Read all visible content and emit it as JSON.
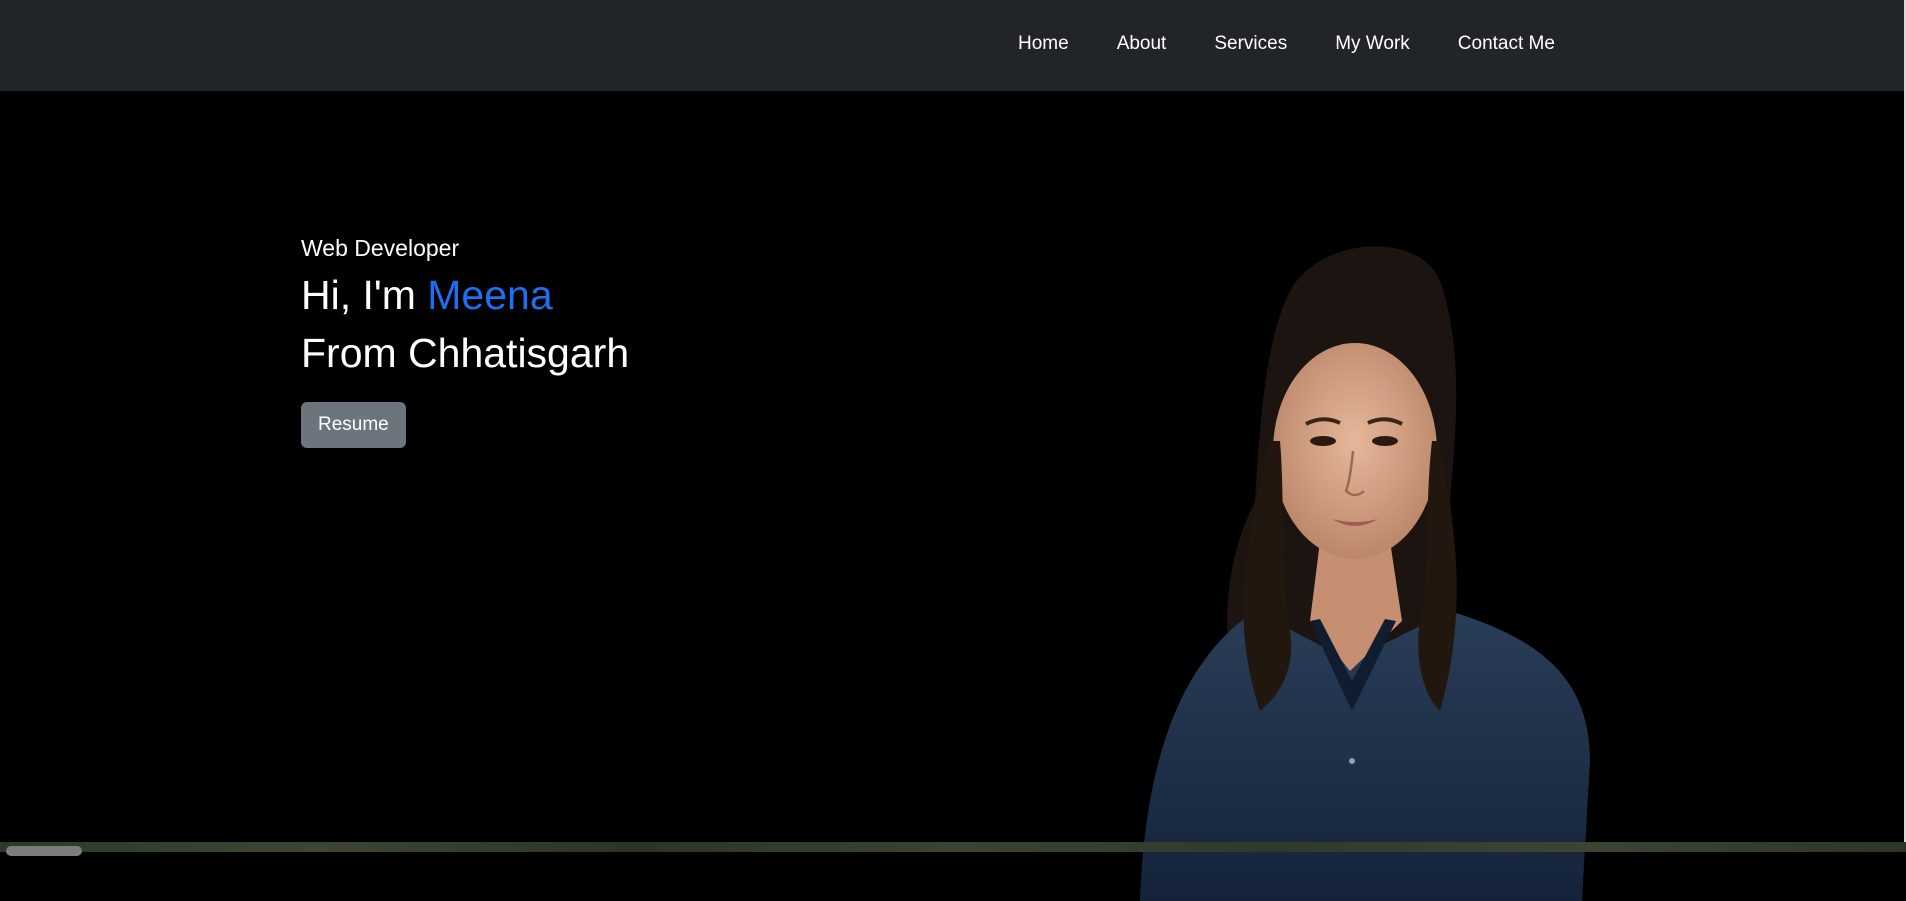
{
  "navbar": {
    "links": [
      "Home",
      "About",
      "Services",
      "My Work",
      "Contact Me"
    ]
  },
  "hero": {
    "subtitle": "Web Developer",
    "greeting": "Hi, I'm ",
    "name": "Meena",
    "origin": "From Chhatisgarh",
    "resume_label": "Resume",
    "accent_color": "#1e6ef2",
    "portrait_alt": "profile photo"
  },
  "colors": {
    "navbar_bg": "#212529",
    "page_bg": "#000000",
    "button_bg": "#6c757d"
  }
}
